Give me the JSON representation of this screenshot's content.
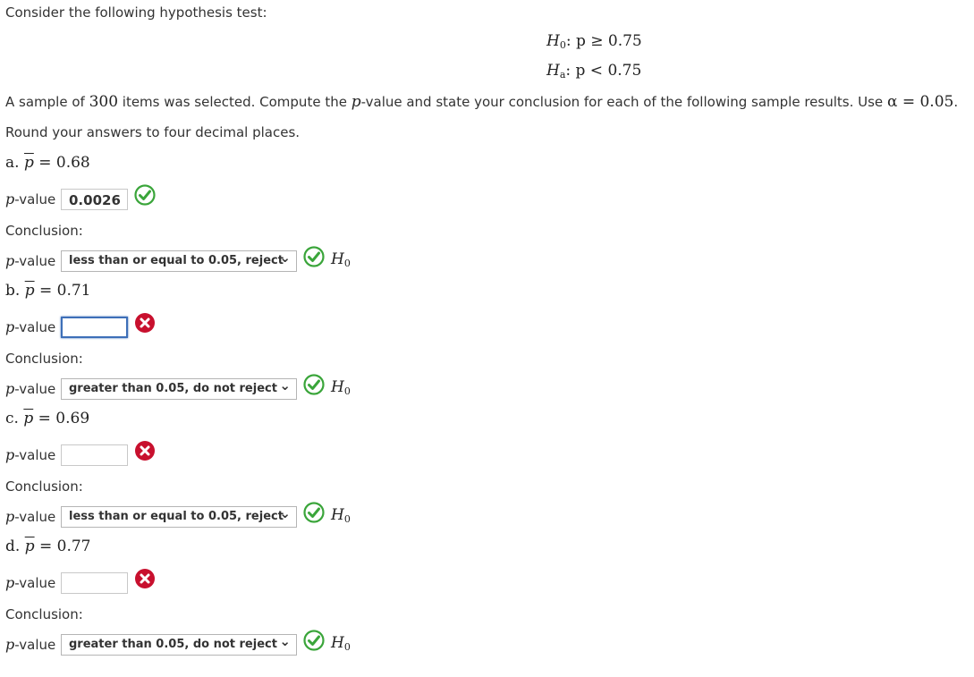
{
  "intro": "Consider the following hypothesis test:",
  "hypotheses": {
    "h0_label": "H",
    "h0_sub": "0",
    "h0_rel": ": p ≥ 0.75",
    "ha_label": "H",
    "ha_sub": "a",
    "ha_rel": ": p < 0.75"
  },
  "instructions": {
    "part1": "A sample of ",
    "sample_size": "300",
    "part2": " items was selected. Compute the ",
    "p_symbol": "p",
    "part3": "-value and state your conclusion for each of the following sample results. Use ",
    "alpha": "α = 0.05",
    "part4": ".",
    "round_note": "Round your answers to four decimal places."
  },
  "labels": {
    "pvalue_suffix": "-value",
    "conclusion": "Conclusion:",
    "h0": "H",
    "h0_sub": "0"
  },
  "parts": [
    {
      "letter": "a.",
      "pbar_eq": "= 0.68",
      "pvalue": "0.0026",
      "pvalue_status": "correct",
      "conclusion": "less than or equal to 0.05, reject",
      "conclusion_status": "correct"
    },
    {
      "letter": "b.",
      "pbar_eq": "= 0.71",
      "pvalue": "",
      "pvalue_status": "incorrect",
      "conclusion": "greater than 0.05, do not reject",
      "conclusion_status": "correct"
    },
    {
      "letter": "c.",
      "pbar_eq": "= 0.69",
      "pvalue": "",
      "pvalue_status": "incorrect",
      "conclusion": "less than or equal to 0.05, reject",
      "conclusion_status": "correct"
    },
    {
      "letter": "d.",
      "pbar_eq": "= 0.77",
      "pvalue": "",
      "pvalue_status": "incorrect",
      "conclusion": "greater than 0.05, do not reject",
      "conclusion_status": "correct"
    }
  ],
  "colors": {
    "correct": "#3aa53a",
    "incorrect": "#c8102e"
  },
  "icons": {
    "correct": "check-circle-icon",
    "incorrect": "x-circle-icon"
  }
}
